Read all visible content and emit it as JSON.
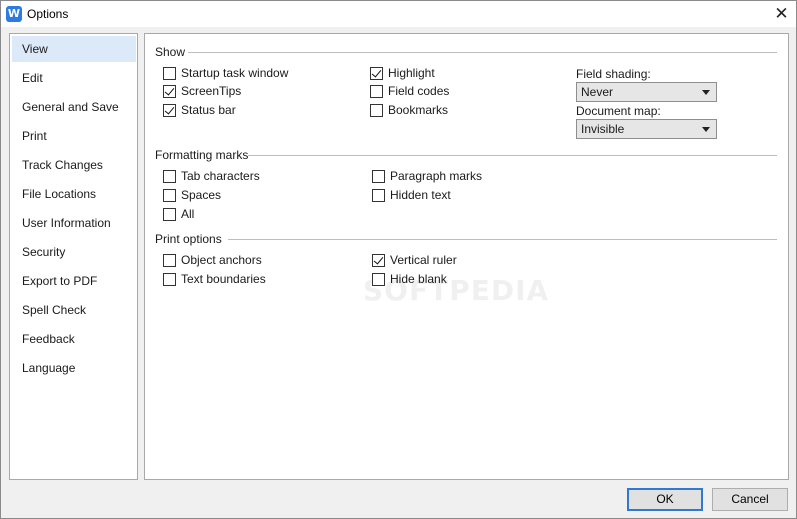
{
  "window": {
    "title": "Options",
    "app_icon_glyph": "W",
    "close_glyph": "✕"
  },
  "sidebar": {
    "items": [
      {
        "label": "View",
        "selected": true
      },
      {
        "label": "Edit"
      },
      {
        "label": "General and Save"
      },
      {
        "label": "Print"
      },
      {
        "label": "Track Changes"
      },
      {
        "label": "File Locations"
      },
      {
        "label": "User Information"
      },
      {
        "label": "Security"
      },
      {
        "label": "Export to PDF"
      },
      {
        "label": "Spell Check"
      },
      {
        "label": "Feedback"
      },
      {
        "label": "Language"
      }
    ]
  },
  "show": {
    "heading": "Show",
    "startup_task_window": {
      "label": "Startup task window",
      "checked": false
    },
    "screentips": {
      "label": "ScreenTips",
      "checked": true
    },
    "status_bar": {
      "label": "Status bar",
      "checked": true
    },
    "highlight": {
      "label": "Highlight",
      "checked": true
    },
    "field_codes": {
      "label": "Field codes",
      "checked": false
    },
    "bookmarks": {
      "label": "Bookmarks",
      "checked": false
    },
    "field_shading": {
      "label": "Field shading:",
      "value": "Never"
    },
    "document_map": {
      "label": "Document map:",
      "value": "Invisible"
    }
  },
  "formatting": {
    "heading": "Formatting marks",
    "tab_characters": {
      "label": "Tab characters",
      "checked": false
    },
    "spaces": {
      "label": "Spaces",
      "checked": false
    },
    "all": {
      "label": "All",
      "checked": false
    },
    "paragraph_marks": {
      "label": "Paragraph marks",
      "checked": false
    },
    "hidden_text": {
      "label": "Hidden text",
      "checked": false
    }
  },
  "print_options": {
    "heading": "Print options",
    "object_anchors": {
      "label": "Object anchors",
      "checked": false
    },
    "text_boundaries": {
      "label": "Text boundaries",
      "checked": false
    },
    "vertical_ruler": {
      "label": "Vertical ruler",
      "checked": true
    },
    "hide_blank": {
      "label": "Hide blank",
      "checked": false
    }
  },
  "buttons": {
    "ok": "OK",
    "cancel": "Cancel"
  },
  "watermark": "SOFTPEDIA",
  "colors": {
    "selected_item_bg": "#dce9f8",
    "accent": "#2f7ad0"
  }
}
